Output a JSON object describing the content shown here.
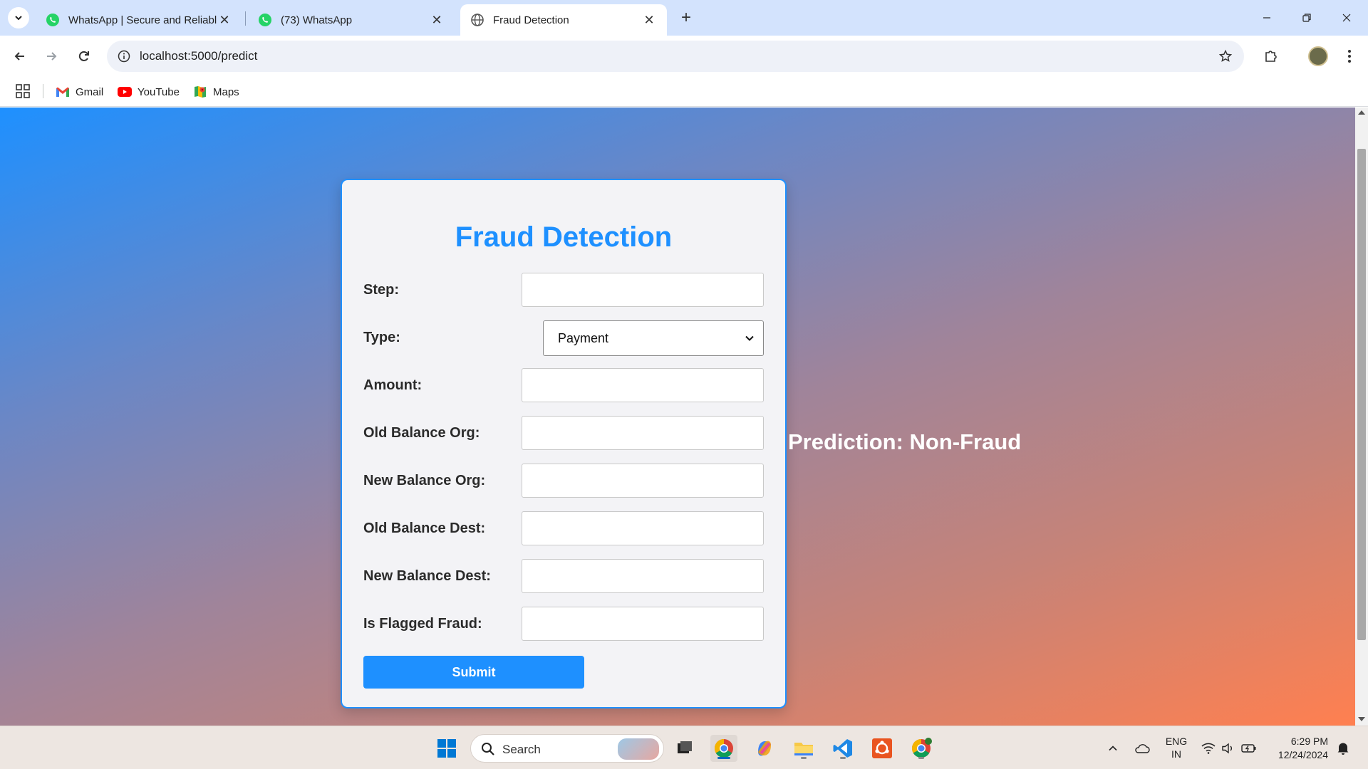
{
  "browser": {
    "tabs": [
      {
        "title": "WhatsApp | Secure and Reliable",
        "icon": "whatsapp-icon"
      },
      {
        "title": "(73) WhatsApp",
        "icon": "whatsapp-icon"
      },
      {
        "title": "Fraud Detection",
        "icon": "globe-icon",
        "active": true
      }
    ],
    "url": "localhost:5000/predict",
    "bookmarks": [
      {
        "label": "Gmail",
        "icon": "gmail-icon"
      },
      {
        "label": "YouTube",
        "icon": "youtube-icon"
      },
      {
        "label": "Maps",
        "icon": "maps-icon"
      }
    ]
  },
  "form": {
    "title": "Fraud Detection",
    "fields": {
      "step": {
        "label": "Step:",
        "value": ""
      },
      "type": {
        "label": "Type:",
        "selected": "Payment"
      },
      "amount": {
        "label": "Amount:",
        "value": ""
      },
      "old_balance_org": {
        "label": "Old Balance Org:",
        "value": ""
      },
      "new_balance_org": {
        "label": "New Balance Org:",
        "value": ""
      },
      "old_balance_dest": {
        "label": "Old Balance Dest:",
        "value": ""
      },
      "new_balance_dest": {
        "label": "New Balance Dest:",
        "value": ""
      },
      "is_flagged_fraud": {
        "label": "Is Flagged Fraud:",
        "value": ""
      }
    },
    "submit_label": "Submit"
  },
  "result": {
    "prediction": "Prediction: Non-Fraud"
  },
  "taskbar": {
    "search_label": "Search",
    "language": {
      "line1": "ENG",
      "line2": "IN"
    },
    "time": "6:29 PM",
    "date": "12/24/2024"
  },
  "colors": {
    "accent": "#1e90ff",
    "gradient_start": "#1e90ff",
    "gradient_end": "#ff8050"
  }
}
